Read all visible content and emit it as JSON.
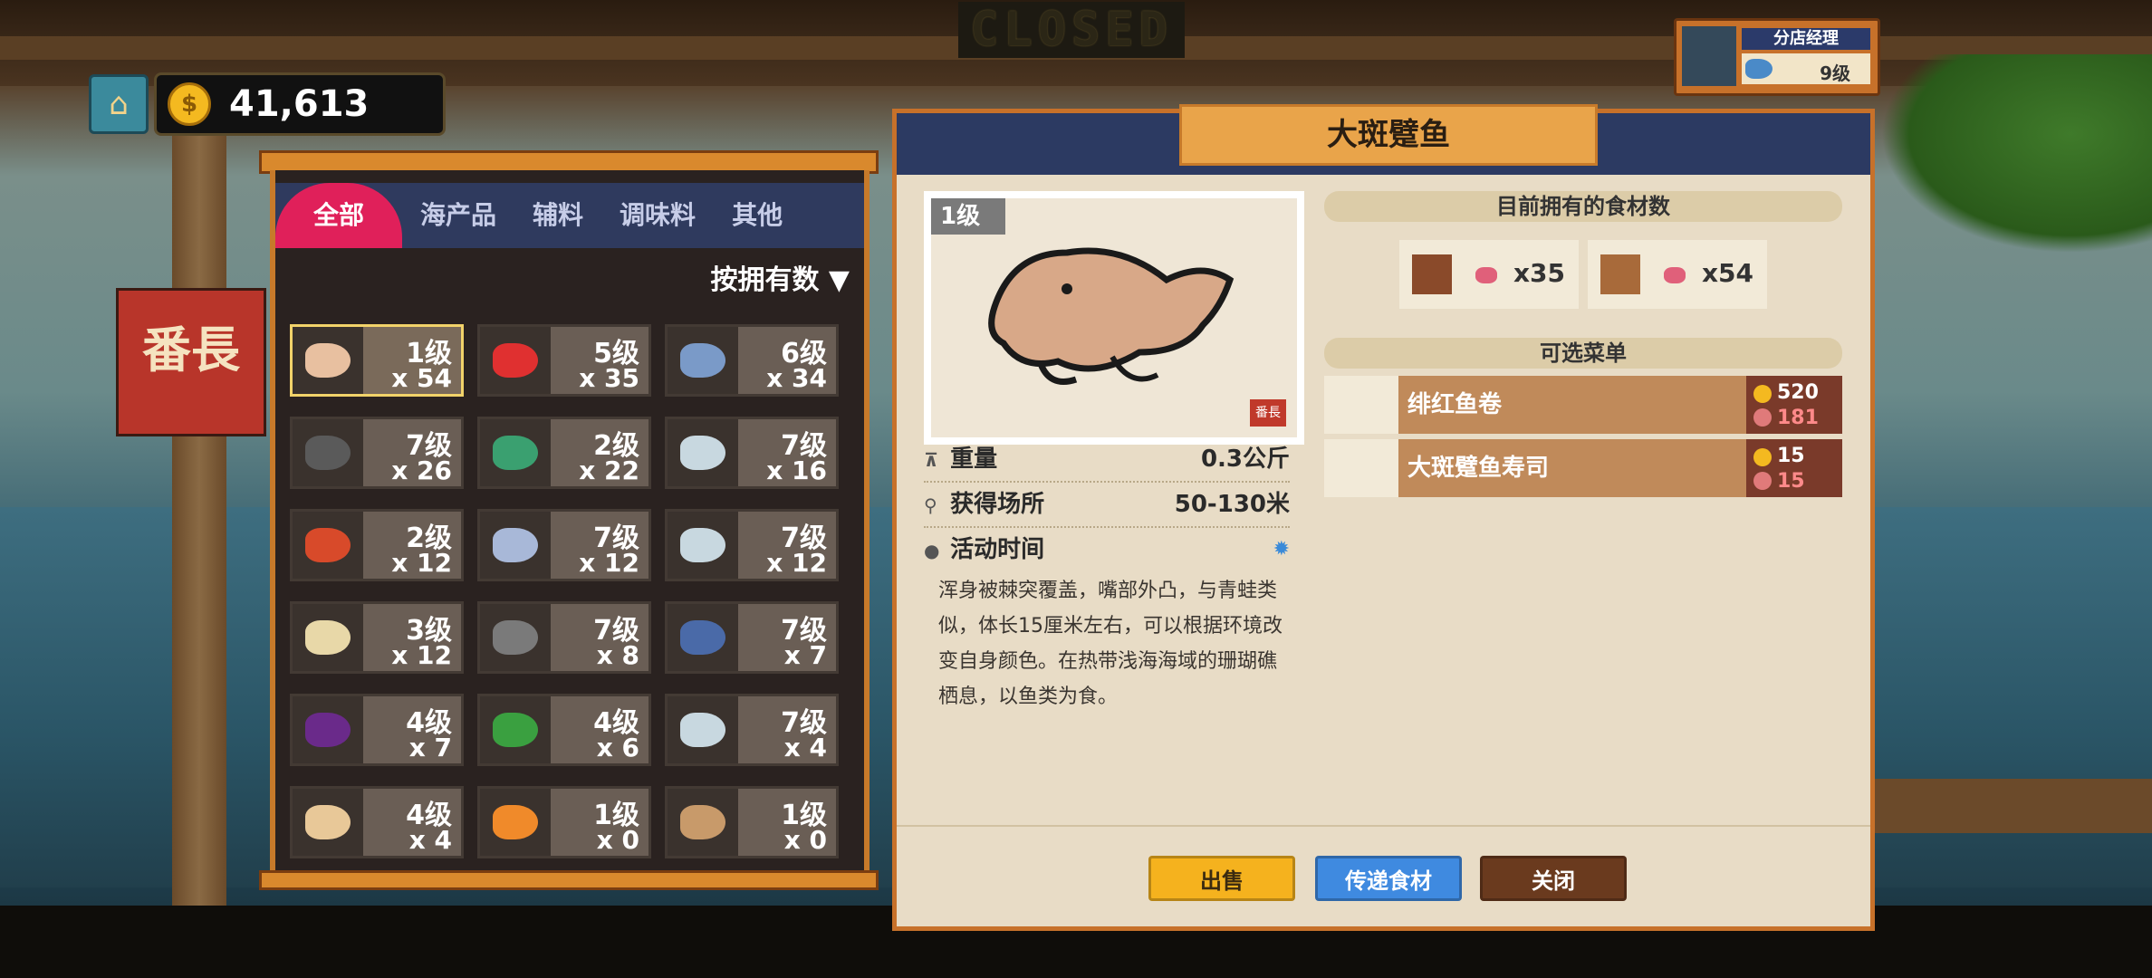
{
  "scene": {
    "closed_sign": "CLOSED",
    "shop_sign": "番長"
  },
  "currency": {
    "gold": "41,613",
    "coin_icon": "$"
  },
  "manager": {
    "title": "分店经理",
    "level": "9级"
  },
  "inventory": {
    "tabs": [
      {
        "label": "全部",
        "active": true
      },
      {
        "label": "海产品"
      },
      {
        "label": "辅料"
      },
      {
        "label": "调味料"
      },
      {
        "label": "其他"
      }
    ],
    "sort_label": "按拥有数 ▼",
    "items": [
      {
        "level": "1级",
        "qty": "x 54",
        "icon": "frogfish",
        "color": "#e8c0a0",
        "selected": true
      },
      {
        "level": "5级",
        "qty": "x 35",
        "icon": "red-fish",
        "color": "#e03030"
      },
      {
        "level": "6级",
        "qty": "x 34",
        "icon": "swordfish",
        "color": "#7a9ac8"
      },
      {
        "level": "7级",
        "qty": "x 26",
        "icon": "eel",
        "color": "#5a5a5a"
      },
      {
        "level": "2级",
        "qty": "x 22",
        "icon": "parrotfish",
        "color": "#3aa070"
      },
      {
        "level": "7级",
        "qty": "x 16",
        "icon": "tuna-head",
        "color": "#c8d8e0"
      },
      {
        "level": "2级",
        "qty": "x 12",
        "icon": "grouper",
        "color": "#d84a2a"
      },
      {
        "level": "7级",
        "qty": "x 12",
        "icon": "needlefish",
        "color": "#a8b8d8"
      },
      {
        "level": "7级",
        "qty": "x 12",
        "icon": "yellowfin-head",
        "color": "#c8d8e0"
      },
      {
        "level": "3级",
        "qty": "x 12",
        "icon": "rice-bag",
        "color": "#e8d8a8"
      },
      {
        "level": "7级",
        "qty": "x 8",
        "icon": "shark",
        "color": "#7a7a7a"
      },
      {
        "level": "7级",
        "qty": "x 7",
        "icon": "bluefin-head",
        "color": "#4a6aa8"
      },
      {
        "level": "4级",
        "qty": "x 7",
        "icon": "eggplant",
        "color": "#6a2a8a"
      },
      {
        "level": "4级",
        "qty": "x 6",
        "icon": "cucumber",
        "color": "#3aa040"
      },
      {
        "level": "7级",
        "qty": "x 4",
        "icon": "tuna-head-2",
        "color": "#c8d8e0"
      },
      {
        "level": "4级",
        "qty": "x 4",
        "icon": "egg",
        "color": "#e8c898"
      },
      {
        "level": "1级",
        "qty": "x 0",
        "icon": "clownfish",
        "color": "#f08a2a"
      },
      {
        "level": "1级",
        "qty": "x 0",
        "icon": "shrimp",
        "color": "#c89a6a"
      }
    ]
  },
  "detail": {
    "title": "大斑躄鱼",
    "art_badge": "1级",
    "art_stamp": "番長",
    "props": [
      {
        "icon": "weight-icon",
        "glyph": "⊼",
        "label": "重量",
        "value": "0.3公斤"
      },
      {
        "icon": "location-icon",
        "glyph": "⚲",
        "label": "获得场所",
        "value": "50-130米"
      },
      {
        "icon": "clock-icon",
        "glyph": "●",
        "label": "活动时间",
        "value": ""
      }
    ],
    "description": "浑身被棘突覆盖，嘴部外凸，与青蛙类似，体长15厘米左右，可以根据环境改变自身颜色。在热带浅海海域的珊瑚礁栖息，以鱼类为食。",
    "owned_header": "目前拥有的食材数",
    "owned": [
      {
        "count": "x35"
      },
      {
        "count": "x54"
      }
    ],
    "menu_header": "可选菜单",
    "menu": [
      {
        "name": "绯红鱼卷",
        "price": "520",
        "taste": "181"
      },
      {
        "name": "大斑躄鱼寿司",
        "price": "15",
        "taste": "15"
      }
    ],
    "buttons": {
      "sell": "出售",
      "send": "传递食材",
      "close": "关闭"
    }
  }
}
